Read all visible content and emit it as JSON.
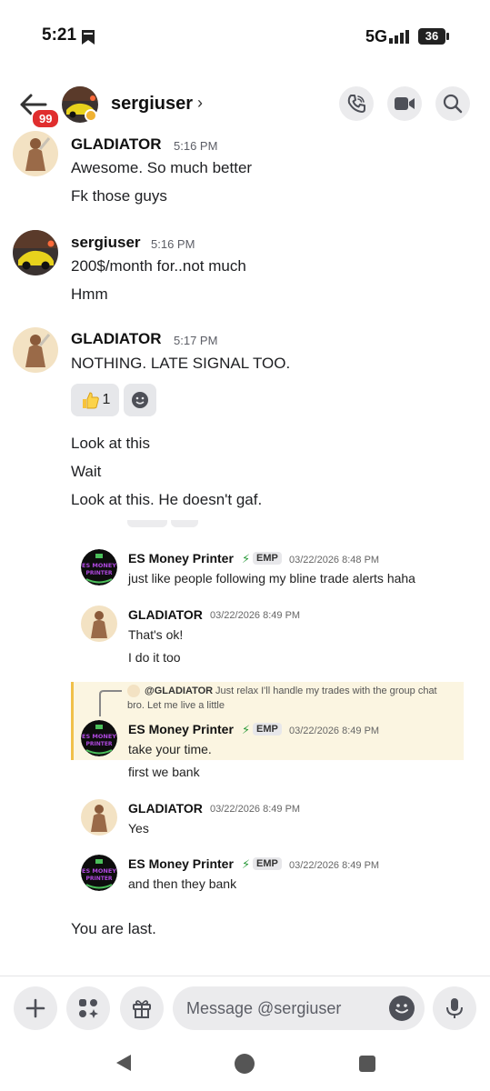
{
  "status_bar": {
    "time": "5:21",
    "network": "5G",
    "battery": "36"
  },
  "header": {
    "badge": "99",
    "name": "sergiuser",
    "chevron": "›",
    "input_placeholder": "Message @sergiuser"
  },
  "messages": [
    {
      "author": "GLADIATOR",
      "time": "5:16 PM",
      "lines": [
        "Awesome. So much better",
        "Fk those guys"
      ]
    },
    {
      "author": "sergiuser",
      "time": "5:16 PM",
      "lines": [
        "200$/month for..not much",
        "Hmm"
      ]
    },
    {
      "author": "GLADIATOR",
      "time": "5:17 PM",
      "lines": [
        "NOTHING. LATE SIGNAL TOO."
      ],
      "reaction_count": "1"
    },
    {
      "lines": [
        "Look at this",
        "Wait",
        "Look at this. He doesn't gaf."
      ]
    },
    {
      "lines": [
        "You are last."
      ]
    }
  ],
  "screenshot": {
    "tag": "EMP",
    "avatar_text": "ES MONEY PRINTER",
    "items": [
      {
        "author": "ES Money Printer",
        "time": "03/22/2026 8:48 PM",
        "lines": [
          "just like people following my bline trade alerts haha"
        ]
      },
      {
        "author": "GLADIATOR",
        "time": "03/22/2026 8:49 PM",
        "lines": [
          "That's ok!",
          "I do it too"
        ]
      },
      {
        "author": "ES Money Printer",
        "time": "03/22/2026 8:49 PM",
        "lines": [
          "take your time.",
          "first we bank"
        ],
        "reply": {
          "mention": "@GLADIATOR",
          "text_1": "Just relax I'll handle my trades with the group chat",
          "text_2": "bro. Let me live a little"
        }
      },
      {
        "author": "GLADIATOR",
        "time": "03/22/2026 8:49 PM",
        "lines": [
          "Yes"
        ]
      },
      {
        "author": "ES Money Printer",
        "time": "03/22/2026 8:49 PM",
        "lines": [
          "and then they bank"
        ]
      }
    ]
  },
  "colors": {
    "badge": "#e02e2e",
    "highlight": "#fbf5e1",
    "highlight_bar": "#f0c04a"
  }
}
